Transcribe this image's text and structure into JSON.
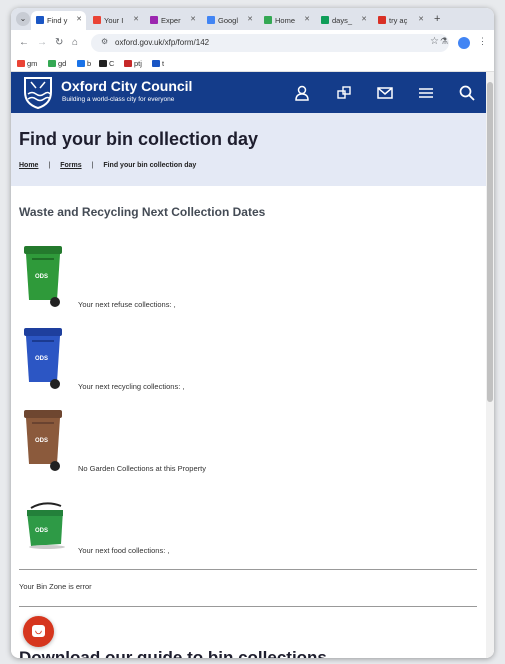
{
  "browser": {
    "tabs": [
      {
        "label": "Find y",
        "color": "#1a56c4"
      },
      {
        "label": "Your I",
        "color": "#ea4335"
      },
      {
        "label": "Exper",
        "color": "#9c27b0"
      },
      {
        "label": "Googl",
        "color": "#4285f4"
      },
      {
        "label": "Home",
        "color": "#34a853"
      },
      {
        "label": "days_",
        "color": "#0f9d58"
      },
      {
        "label": "try aç",
        "color": "#d93025"
      }
    ],
    "url": "oxford.gov.uk/xfp/form/142",
    "bookmarks": [
      {
        "label": "gm",
        "color": "#ea4335"
      },
      {
        "label": "gd",
        "color": "#34a853"
      },
      {
        "label": "b",
        "color": "#1a73e8"
      },
      {
        "label": "C",
        "color": "#222222"
      },
      {
        "label": "ptj",
        "color": "#c62828"
      },
      {
        "label": "t",
        "color": "#1a56c4"
      }
    ]
  },
  "site": {
    "name": "Oxford City Council",
    "tagline": "Building a world-class city for everyone",
    "header_icons": [
      "account-icon",
      "apps-icon",
      "mail-icon",
      "menu-icon",
      "search-icon"
    ],
    "brand_color": "#143c8a"
  },
  "page": {
    "title": "Find your bin collection day",
    "breadcrumb": {
      "home": "Home",
      "forms": "Forms",
      "current": "Find your bin collection day",
      "separator": "|"
    },
    "section_heading": "Waste and Recycling Next Collection Dates",
    "bins": [
      {
        "type": "refuse",
        "color": "#2f9a3a",
        "text": "Your next refuse collections: ,"
      },
      {
        "type": "recycling",
        "color": "#2c56c4",
        "text": "Your next recycling collections: ,"
      },
      {
        "type": "garden",
        "color": "#8b5a3c",
        "text": "No Garden Collections at this Property"
      },
      {
        "type": "food",
        "color": "#2e9a46",
        "text": "Your next food collections: ,"
      }
    ],
    "bin_zone": "Your Bin Zone is error",
    "download_heading": "Download our guide to bin collections"
  }
}
